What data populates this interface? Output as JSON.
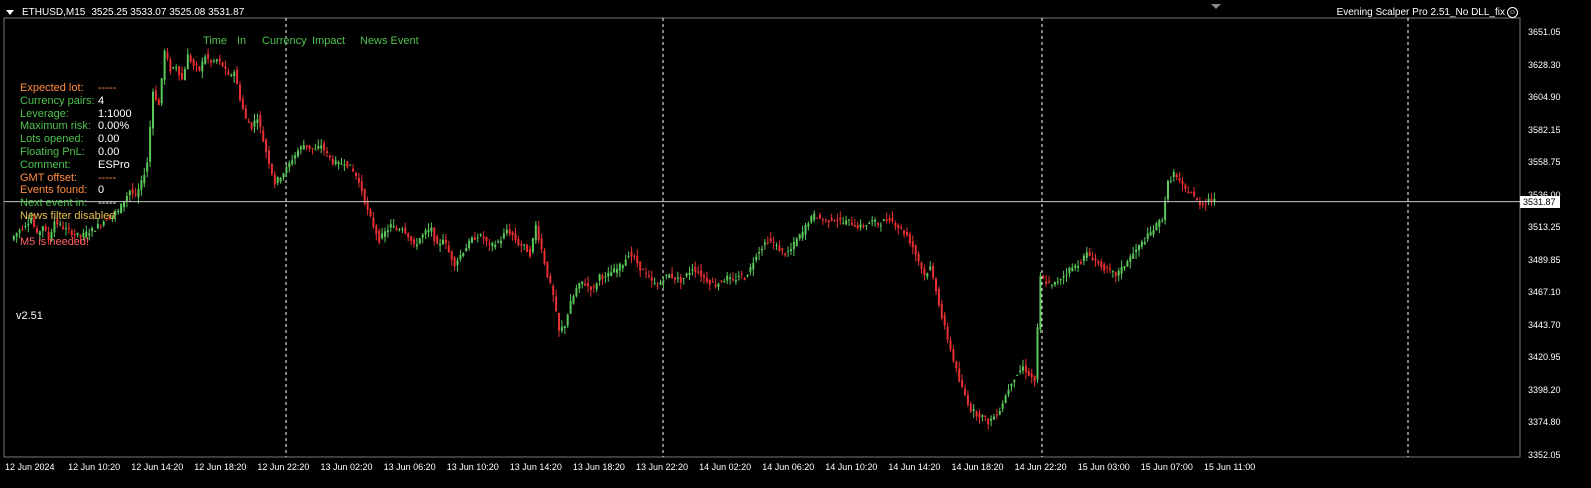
{
  "header": {
    "symbol": "ETHUSD,M15",
    "ohlc": "3525.25 3533.07 3525.08 3531.87",
    "ea_name": "Evening Scalper Pro 2.51_No DLL_fix"
  },
  "news_header": [
    "Time",
    "In",
    "Currency",
    "Impact",
    "News Event"
  ],
  "info_panel": [
    {
      "label": "Expected lot:",
      "value": "-----",
      "label_color": "orange",
      "value_color": "orange"
    },
    {
      "label": "Currency pairs:",
      "value": "4",
      "label_color": "green",
      "value_color": "white"
    },
    {
      "label": "Leverage:",
      "value": "1:1000",
      "label_color": "green",
      "value_color": "white"
    },
    {
      "label": "Maximum risk:",
      "value": "0.00%",
      "label_color": "green",
      "value_color": "white"
    },
    {
      "label": "Lots opened:",
      "value": "0.00",
      "label_color": "green",
      "value_color": "white"
    },
    {
      "label": "Floating PnL:",
      "value": "0.00",
      "label_color": "green",
      "value_color": "white"
    },
    {
      "label": "Comment:",
      "value": "ESPro",
      "label_color": "green",
      "value_color": "white"
    },
    {
      "label": "GMT offset:",
      "value": "-----",
      "label_color": "orange",
      "value_color": "orange"
    },
    {
      "label": "Events found:",
      "value": "0",
      "label_color": "orange",
      "value_color": "white"
    },
    {
      "label": "Next event in:",
      "value": "-----",
      "label_color": "green",
      "value_color": "white"
    },
    {
      "label": "News filter disabled",
      "value": "",
      "label_color": "yellow",
      "value_color": "white"
    },
    {
      "label": "",
      "value": "",
      "label_color": "white",
      "value_color": "white"
    },
    {
      "label": "M5 is needed!",
      "value": "",
      "label_color": "red",
      "value_color": "white"
    }
  ],
  "version": "v2.51",
  "current_price": "3531.87",
  "colors": {
    "orange": "#ff8c42",
    "green": "#4fc24f",
    "white": "#ffffff",
    "yellow": "#e8c050",
    "red": "#ff6060",
    "bull": "#5ac85a",
    "bear": "#e83030",
    "background": "#000000"
  },
  "chart_data": {
    "type": "candlestick",
    "price_ticks": [
      "3651.05",
      "3628.30",
      "3604.90",
      "3582.15",
      "3558.75",
      "3536.00",
      "3513.25",
      "3489.85",
      "3467.10",
      "3443.70",
      "3420.95",
      "3398.20",
      "3374.80",
      "3352.05"
    ],
    "time_ticks": [
      "12 Jun 2024",
      "12 Jun 10:20",
      "12 Jun 14:20",
      "12 Jun 18:20",
      "12 Jun 22:20",
      "13 Jun 02:20",
      "13 Jun 06:20",
      "13 Jun 10:20",
      "13 Jun 14:20",
      "13 Jun 18:20",
      "13 Jun 22:20",
      "14 Jun 02:20",
      "14 Jun 06:20",
      "14 Jun 10:20",
      "14 Jun 14:20",
      "14 Jun 18:20",
      "14 Jun 22:20",
      "15 Jun 03:00",
      "15 Jun 07:00",
      "15 Jun 11:00"
    ],
    "ylim": [
      3352.05,
      3651.05
    ],
    "current_price": 3531.87,
    "close_path": [
      [
        1,
        3505
      ],
      [
        4,
        3512
      ],
      [
        8,
        3520
      ],
      [
        10,
        3508
      ],
      [
        12,
        3515
      ],
      [
        14,
        3505
      ],
      [
        16,
        3518
      ],
      [
        20,
        3512
      ],
      [
        25,
        3507
      ],
      [
        30,
        3513
      ],
      [
        34,
        3520
      ],
      [
        38,
        3525
      ],
      [
        42,
        3540
      ],
      [
        44,
        3535
      ],
      [
        46,
        3545
      ],
      [
        48,
        3560
      ],
      [
        50,
        3610
      ],
      [
        52,
        3600
      ],
      [
        54,
        3638
      ],
      [
        56,
        3625
      ],
      [
        58,
        3628
      ],
      [
        60,
        3618
      ],
      [
        62,
        3635
      ],
      [
        64,
        3628
      ],
      [
        66,
        3625
      ],
      [
        68,
        3635
      ],
      [
        70,
        3630
      ],
      [
        72,
        3632
      ],
      [
        74,
        3628
      ],
      [
        76,
        3620
      ],
      [
        78,
        3624
      ],
      [
        80,
        3605
      ],
      [
        82,
        3590
      ],
      [
        84,
        3585
      ],
      [
        86,
        3592
      ],
      [
        88,
        3575
      ],
      [
        90,
        3560
      ],
      [
        92,
        3545
      ],
      [
        94,
        3550
      ],
      [
        96,
        3555
      ],
      [
        98,
        3562
      ],
      [
        100,
        3568
      ],
      [
        102,
        3572
      ],
      [
        104,
        3570
      ],
      [
        106,
        3568
      ],
      [
        108,
        3572
      ],
      [
        110,
        3565
      ],
      [
        112,
        3560
      ],
      [
        114,
        3558
      ],
      [
        116,
        3560
      ],
      [
        118,
        3556
      ],
      [
        120,
        3550
      ],
      [
        122,
        3540
      ],
      [
        124,
        3525
      ],
      [
        126,
        3515
      ],
      [
        128,
        3505
      ],
      [
        130,
        3510
      ],
      [
        132,
        3515
      ],
      [
        134,
        3512
      ],
      [
        136,
        3514
      ],
      [
        138,
        3508
      ],
      [
        140,
        3500
      ],
      [
        142,
        3506
      ],
      [
        144,
        3510
      ],
      [
        146,
        3512
      ],
      [
        148,
        3500
      ],
      [
        150,
        3506
      ],
      [
        152,
        3496
      ],
      [
        154,
        3488
      ],
      [
        156,
        3494
      ],
      [
        158,
        3500
      ],
      [
        160,
        3505
      ],
      [
        162,
        3508
      ],
      [
        164,
        3506
      ],
      [
        166,
        3500
      ],
      [
        168,
        3502
      ],
      [
        170,
        3505
      ],
      [
        172,
        3512
      ],
      [
        174,
        3508
      ],
      [
        176,
        3502
      ],
      [
        178,
        3500
      ],
      [
        180,
        3495
      ],
      [
        182,
        3515
      ],
      [
        184,
        3498
      ],
      [
        186,
        3480
      ],
      [
        188,
        3465
      ],
      [
        190,
        3440
      ],
      [
        192,
        3445
      ],
      [
        194,
        3460
      ],
      [
        196,
        3470
      ],
      [
        198,
        3475
      ],
      [
        200,
        3472
      ],
      [
        202,
        3470
      ],
      [
        204,
        3480
      ],
      [
        206,
        3478
      ],
      [
        208,
        3482
      ],
      [
        210,
        3484
      ],
      [
        212,
        3488
      ],
      [
        214,
        3495
      ],
      [
        216,
        3492
      ],
      [
        218,
        3485
      ],
      [
        220,
        3480
      ],
      [
        222,
        3475
      ],
      [
        224,
        3472
      ],
      [
        226,
        3478
      ],
      [
        228,
        3480
      ],
      [
        230,
        3478
      ],
      [
        232,
        3476
      ],
      [
        234,
        3480
      ],
      [
        236,
        3485
      ],
      [
        238,
        3482
      ],
      [
        240,
        3478
      ],
      [
        242,
        3475
      ],
      [
        244,
        3473
      ],
      [
        246,
        3476
      ],
      [
        248,
        3478
      ],
      [
        250,
        3475
      ],
      [
        252,
        3480
      ],
      [
        254,
        3478
      ],
      [
        256,
        3485
      ],
      [
        258,
        3495
      ],
      [
        260,
        3500
      ],
      [
        262,
        3505
      ],
      [
        264,
        3502
      ],
      [
        266,
        3498
      ],
      [
        268,
        3495
      ],
      [
        270,
        3498
      ],
      [
        272,
        3505
      ],
      [
        274,
        3510
      ],
      [
        276,
        3518
      ],
      [
        278,
        3522
      ],
      [
        280,
        3520
      ],
      [
        282,
        3518
      ],
      [
        284,
        3520
      ],
      [
        286,
        3519
      ],
      [
        288,
        3517
      ],
      [
        290,
        3518
      ],
      [
        292,
        3515
      ],
      [
        294,
        3514
      ],
      [
        296,
        3516
      ],
      [
        298,
        3518
      ],
      [
        300,
        3516
      ],
      [
        302,
        3518
      ],
      [
        304,
        3520
      ],
      [
        306,
        3516
      ],
      [
        308,
        3512
      ],
      [
        310,
        3508
      ],
      [
        312,
        3500
      ],
      [
        314,
        3490
      ],
      [
        316,
        3480
      ],
      [
        318,
        3485
      ],
      [
        320,
        3470
      ],
      [
        322,
        3450
      ],
      [
        324,
        3435
      ],
      [
        326,
        3420
      ],
      [
        328,
        3405
      ],
      [
        330,
        3395
      ],
      [
        332,
        3385
      ],
      [
        334,
        3382
      ],
      [
        336,
        3380
      ],
      [
        338,
        3376
      ],
      [
        340,
        3380
      ],
      [
        342,
        3385
      ],
      [
        344,
        3395
      ],
      [
        346,
        3405
      ],
      [
        348,
        3410
      ],
      [
        350,
        3415
      ],
      [
        352,
        3410
      ],
      [
        354,
        3405
      ],
      [
        356,
        3478
      ],
      [
        358,
        3475
      ],
      [
        360,
        3472
      ],
      [
        362,
        3476
      ],
      [
        364,
        3480
      ],
      [
        366,
        3484
      ],
      [
        368,
        3486
      ],
      [
        370,
        3490
      ],
      [
        372,
        3495
      ],
      [
        374,
        3492
      ],
      [
        376,
        3488
      ],
      [
        378,
        3485
      ],
      [
        380,
        3482
      ],
      [
        382,
        3480
      ],
      [
        384,
        3484
      ],
      [
        386,
        3490
      ],
      [
        388,
        3495
      ],
      [
        390,
        3500
      ],
      [
        392,
        3505
      ],
      [
        394,
        3510
      ],
      [
        396,
        3515
      ],
      [
        398,
        3520
      ],
      [
        400,
        3545
      ],
      [
        402,
        3552
      ],
      [
        404,
        3545
      ],
      [
        406,
        3540
      ],
      [
        408,
        3538
      ],
      [
        410,
        3532
      ],
      [
        412,
        3530
      ],
      [
        414,
        3534
      ],
      [
        416,
        3532
      ]
    ]
  }
}
